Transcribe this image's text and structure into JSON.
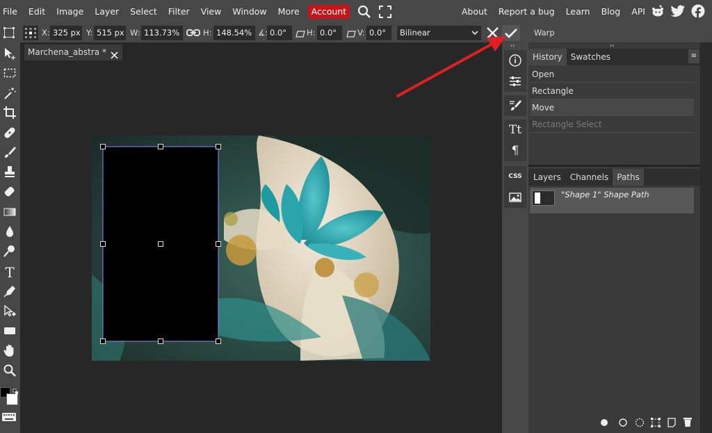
{
  "menu": {
    "items": [
      "File",
      "Edit",
      "Image",
      "Layer",
      "Select",
      "Filter",
      "View",
      "Window",
      "More"
    ],
    "account": "Account",
    "right_links": [
      "About",
      "Report a bug",
      "Learn",
      "Blog",
      "API"
    ]
  },
  "options": {
    "x_label": "X:",
    "x_value": "325 px",
    "y_label": "Y:",
    "y_value": "515 px",
    "w_label": "W:",
    "w_value": "113.73%",
    "h_label": "H:",
    "h_value": "148.54%",
    "angle_label": "∡:",
    "angle_value": "0.0°",
    "skew_h_label": "H:",
    "skew_h_value": "0.0°",
    "skew_v_label": "V:",
    "skew_v_value": "0.0°",
    "interpolation": "Bilinear",
    "warp_label": "Warp"
  },
  "document": {
    "tab_title": "Marchena_abstra *"
  },
  "history": {
    "tabs": [
      "History",
      "Swatches"
    ],
    "items": [
      {
        "label": "Open"
      },
      {
        "label": "Rectangle"
      },
      {
        "label": "Move"
      },
      {
        "label": "Rectangle Select"
      }
    ]
  },
  "layers": {
    "tabs": [
      "Layers",
      "Channels",
      "Paths"
    ],
    "path_name": "\"Shape 1\" Shape Path"
  },
  "colors": {
    "accent": "#c4151c",
    "arrow": "#e02020"
  }
}
